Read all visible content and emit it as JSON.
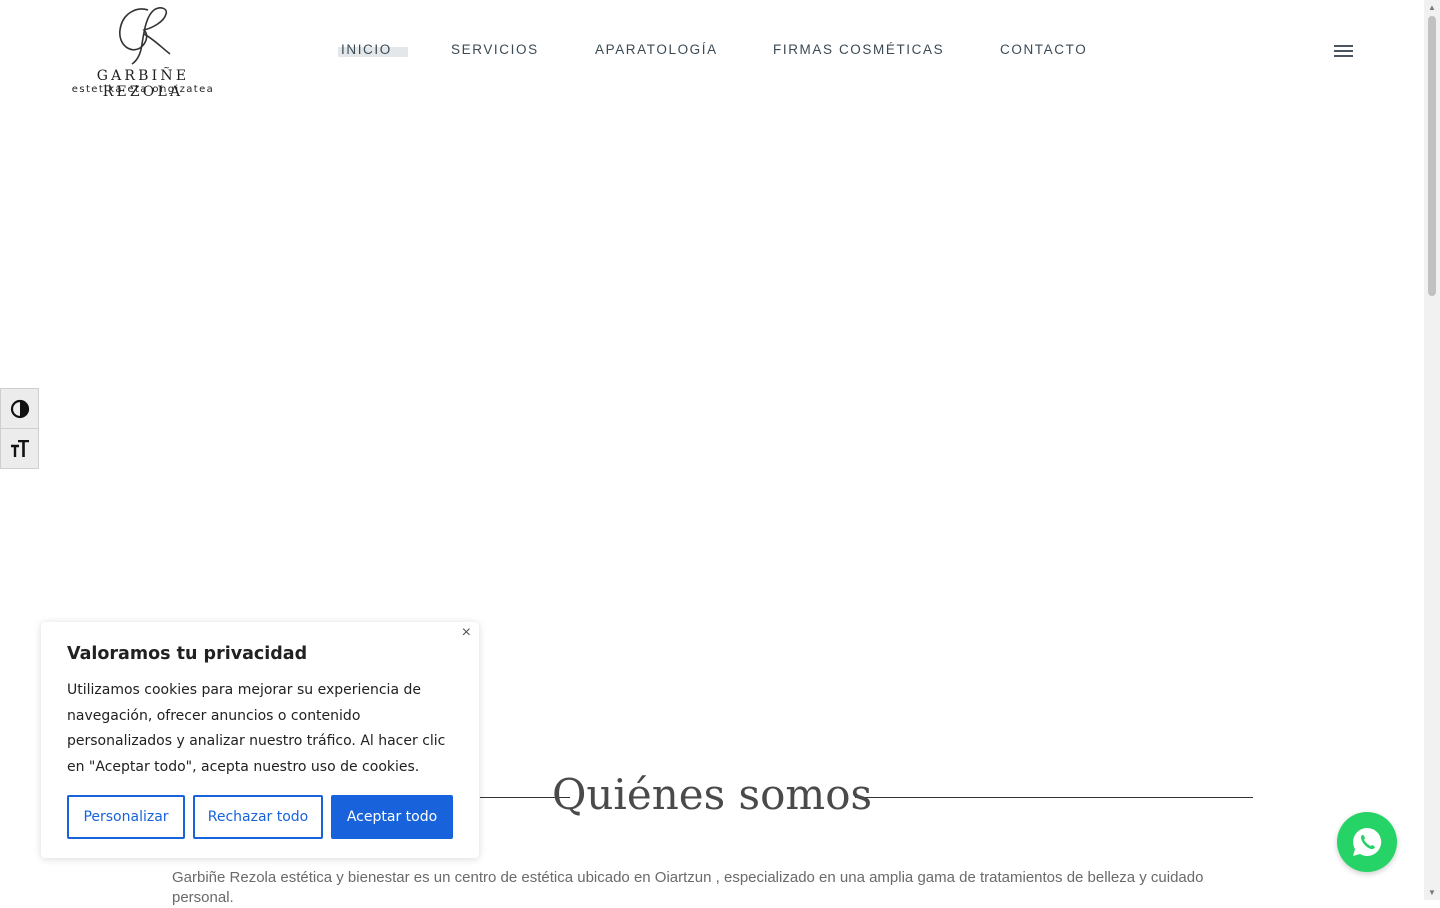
{
  "logo": {
    "name": "GARBIÑE REZOLA",
    "tagline": "estetika eta ongizatea"
  },
  "nav": {
    "items": [
      {
        "label": "INICIO",
        "active": true
      },
      {
        "label": "SERVICIOS"
      },
      {
        "label": "APARATOLOGÍA"
      },
      {
        "label": "FIRMAS COSMÉTICAS"
      },
      {
        "label": "CONTACTO"
      }
    ]
  },
  "a11y": {
    "contrast_icon": "contrast-icon",
    "font_size_icon": "text-size-icon"
  },
  "section": {
    "title": "Quiénes somos",
    "intro": "Garbiñe Rezola estética y bienestar es un centro de estética ubicado en Oiartzun , especializado en una amplia gama de tratamientos de belleza y cuidado personal."
  },
  "cookie": {
    "title": "Valoramos tu privacidad",
    "text": "Utilizamos cookies para mejorar su experiencia de navegación, ofrecer anuncios o contenido personalizados y analizar nuestro tráfico. Al hacer clic en \"Aceptar todo\", acepta nuestro uso de cookies.",
    "customize_label": "Personalizar",
    "reject_label": "Rechazar todo",
    "accept_label": "Aceptar todo",
    "close_symbol": "×"
  },
  "colors": {
    "accent": "#1863dc",
    "whatsapp": "#25d366",
    "nav_text": "#3b4a55"
  }
}
